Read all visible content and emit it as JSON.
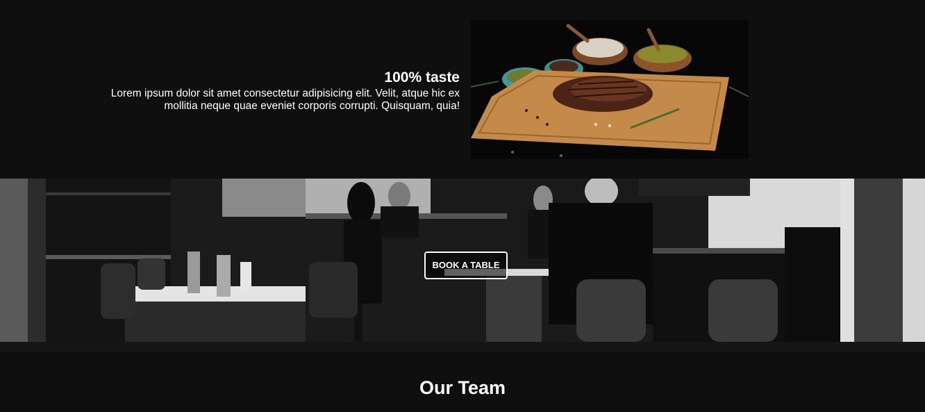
{
  "taste": {
    "title": "100% taste",
    "body": "Lorem ipsum dolor sit amet consectetur adipisicing elit. Velit, atque hic ex mollitia neque quae eveniet corporis corrupti. Quisquam, quia!"
  },
  "banner": {
    "button_label": "BOOK A TABLE"
  },
  "team": {
    "title": "Our Team"
  },
  "colors": {
    "background": "#0f0f0f",
    "text": "#ffffff"
  }
}
